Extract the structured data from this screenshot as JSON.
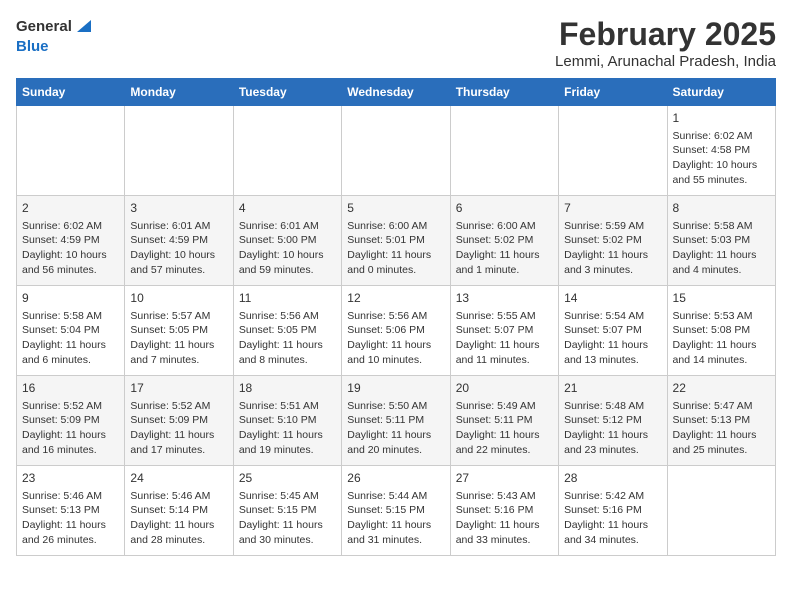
{
  "header": {
    "logo_general": "General",
    "logo_blue": "Blue",
    "title": "February 2025",
    "subtitle": "Lemmi, Arunachal Pradesh, India"
  },
  "weekdays": [
    "Sunday",
    "Monday",
    "Tuesday",
    "Wednesday",
    "Thursday",
    "Friday",
    "Saturday"
  ],
  "weeks": [
    [
      {
        "day": "",
        "info": ""
      },
      {
        "day": "",
        "info": ""
      },
      {
        "day": "",
        "info": ""
      },
      {
        "day": "",
        "info": ""
      },
      {
        "day": "",
        "info": ""
      },
      {
        "day": "",
        "info": ""
      },
      {
        "day": "1",
        "info": "Sunrise: 6:02 AM\nSunset: 4:58 PM\nDaylight: 10 hours and 55 minutes."
      }
    ],
    [
      {
        "day": "2",
        "info": "Sunrise: 6:02 AM\nSunset: 4:59 PM\nDaylight: 10 hours and 56 minutes."
      },
      {
        "day": "3",
        "info": "Sunrise: 6:01 AM\nSunset: 4:59 PM\nDaylight: 10 hours and 57 minutes."
      },
      {
        "day": "4",
        "info": "Sunrise: 6:01 AM\nSunset: 5:00 PM\nDaylight: 10 hours and 59 minutes."
      },
      {
        "day": "5",
        "info": "Sunrise: 6:00 AM\nSunset: 5:01 PM\nDaylight: 11 hours and 0 minutes."
      },
      {
        "day": "6",
        "info": "Sunrise: 6:00 AM\nSunset: 5:02 PM\nDaylight: 11 hours and 1 minute."
      },
      {
        "day": "7",
        "info": "Sunrise: 5:59 AM\nSunset: 5:02 PM\nDaylight: 11 hours and 3 minutes."
      },
      {
        "day": "8",
        "info": "Sunrise: 5:58 AM\nSunset: 5:03 PM\nDaylight: 11 hours and 4 minutes."
      }
    ],
    [
      {
        "day": "9",
        "info": "Sunrise: 5:58 AM\nSunset: 5:04 PM\nDaylight: 11 hours and 6 minutes."
      },
      {
        "day": "10",
        "info": "Sunrise: 5:57 AM\nSunset: 5:05 PM\nDaylight: 11 hours and 7 minutes."
      },
      {
        "day": "11",
        "info": "Sunrise: 5:56 AM\nSunset: 5:05 PM\nDaylight: 11 hours and 8 minutes."
      },
      {
        "day": "12",
        "info": "Sunrise: 5:56 AM\nSunset: 5:06 PM\nDaylight: 11 hours and 10 minutes."
      },
      {
        "day": "13",
        "info": "Sunrise: 5:55 AM\nSunset: 5:07 PM\nDaylight: 11 hours and 11 minutes."
      },
      {
        "day": "14",
        "info": "Sunrise: 5:54 AM\nSunset: 5:07 PM\nDaylight: 11 hours and 13 minutes."
      },
      {
        "day": "15",
        "info": "Sunrise: 5:53 AM\nSunset: 5:08 PM\nDaylight: 11 hours and 14 minutes."
      }
    ],
    [
      {
        "day": "16",
        "info": "Sunrise: 5:52 AM\nSunset: 5:09 PM\nDaylight: 11 hours and 16 minutes."
      },
      {
        "day": "17",
        "info": "Sunrise: 5:52 AM\nSunset: 5:09 PM\nDaylight: 11 hours and 17 minutes."
      },
      {
        "day": "18",
        "info": "Sunrise: 5:51 AM\nSunset: 5:10 PM\nDaylight: 11 hours and 19 minutes."
      },
      {
        "day": "19",
        "info": "Sunrise: 5:50 AM\nSunset: 5:11 PM\nDaylight: 11 hours and 20 minutes."
      },
      {
        "day": "20",
        "info": "Sunrise: 5:49 AM\nSunset: 5:11 PM\nDaylight: 11 hours and 22 minutes."
      },
      {
        "day": "21",
        "info": "Sunrise: 5:48 AM\nSunset: 5:12 PM\nDaylight: 11 hours and 23 minutes."
      },
      {
        "day": "22",
        "info": "Sunrise: 5:47 AM\nSunset: 5:13 PM\nDaylight: 11 hours and 25 minutes."
      }
    ],
    [
      {
        "day": "23",
        "info": "Sunrise: 5:46 AM\nSunset: 5:13 PM\nDaylight: 11 hours and 26 minutes."
      },
      {
        "day": "24",
        "info": "Sunrise: 5:46 AM\nSunset: 5:14 PM\nDaylight: 11 hours and 28 minutes."
      },
      {
        "day": "25",
        "info": "Sunrise: 5:45 AM\nSunset: 5:15 PM\nDaylight: 11 hours and 30 minutes."
      },
      {
        "day": "26",
        "info": "Sunrise: 5:44 AM\nSunset: 5:15 PM\nDaylight: 11 hours and 31 minutes."
      },
      {
        "day": "27",
        "info": "Sunrise: 5:43 AM\nSunset: 5:16 PM\nDaylight: 11 hours and 33 minutes."
      },
      {
        "day": "28",
        "info": "Sunrise: 5:42 AM\nSunset: 5:16 PM\nDaylight: 11 hours and 34 minutes."
      },
      {
        "day": "",
        "info": ""
      }
    ]
  ]
}
